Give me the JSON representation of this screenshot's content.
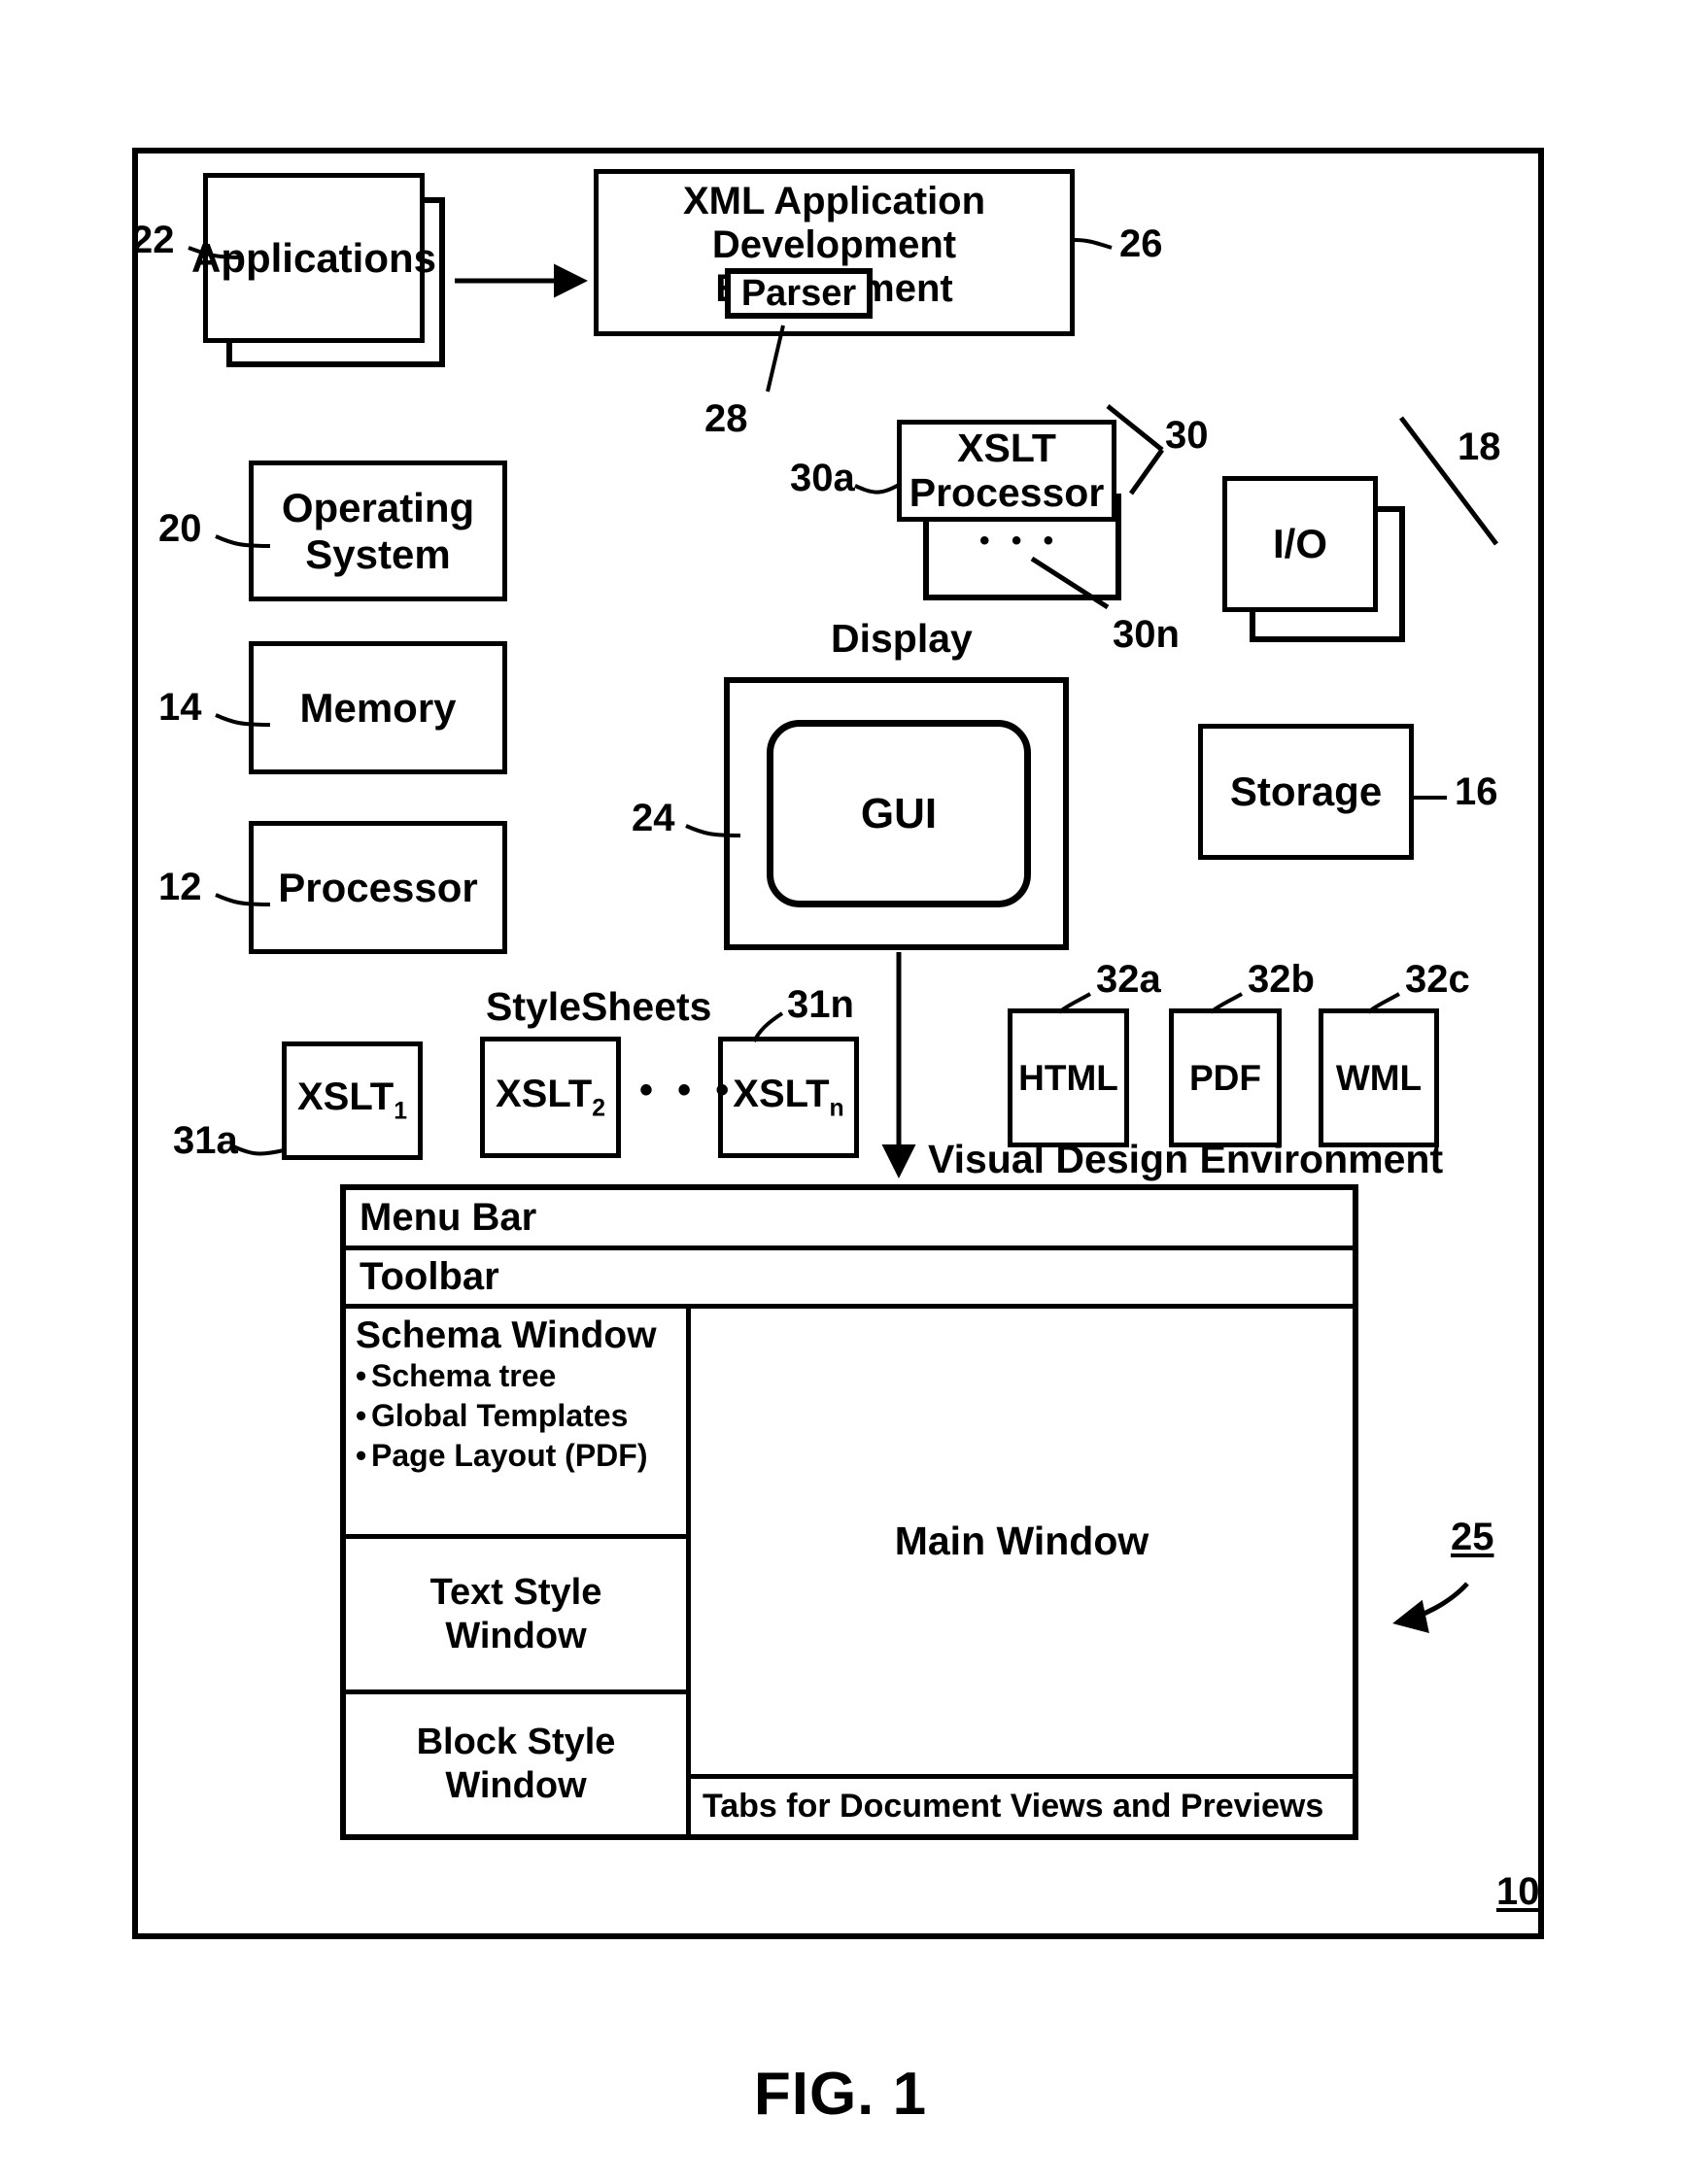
{
  "figure": {
    "caption": "FIG. 1",
    "system_ref": "10"
  },
  "refs": {
    "system": "10",
    "processor": "12",
    "memory": "14",
    "storage": "16",
    "io": "18",
    "operating_system": "20",
    "applications": "22",
    "gui": "24",
    "visual_design_window": "25",
    "xml_ade": "26",
    "parser": "28",
    "xslt_processors": "30",
    "xslt_processor_first": "30a",
    "xslt_processor_last": "30n",
    "stylesheet_first": "31a",
    "stylesheet_last": "31n",
    "output_html": "32a",
    "output_pdf": "32b",
    "output_wml": "32c"
  },
  "blocks": {
    "applications": "Applications",
    "xml_ade_line1": "XML Application",
    "xml_ade_line2": "Development Environment",
    "parser": "Parser",
    "xslt_processor_line1": "XSLT",
    "xslt_processor_line2": "Processor",
    "io": "I/O",
    "operating_system_line1": "Operating",
    "operating_system_line2": "System",
    "memory": "Memory",
    "processor": "Processor",
    "storage": "Storage",
    "display_label": "Display",
    "gui": "GUI",
    "stylesheets_label": "StyleSheets",
    "stylesheet_1_base": "XSLT",
    "stylesheet_1_sub": "1",
    "stylesheet_2_base": "XSLT",
    "stylesheet_2_sub": "2",
    "stylesheet_n_base": "XSLT",
    "stylesheet_n_sub": "n",
    "ellipsis": "• • •",
    "output_html": "HTML",
    "output_pdf": "PDF",
    "output_wml": "WML",
    "visual_design_environment": "Visual Design Environment"
  },
  "vde": {
    "menu_bar": "Menu Bar",
    "toolbar": "Toolbar",
    "schema_window_title": "Schema Window",
    "schema_items": [
      "Schema tree",
      "Global Templates",
      "Page Layout (PDF)"
    ],
    "text_style_window_line1": "Text Style",
    "text_style_window_line2": "Window",
    "block_style_window_line1": "Block Style",
    "block_style_window_line2": "Window",
    "main_window": "Main Window",
    "tabs_bar": "Tabs for Document Views and Previews"
  },
  "colors": {
    "ink": "#000000",
    "paper": "#ffffff"
  }
}
